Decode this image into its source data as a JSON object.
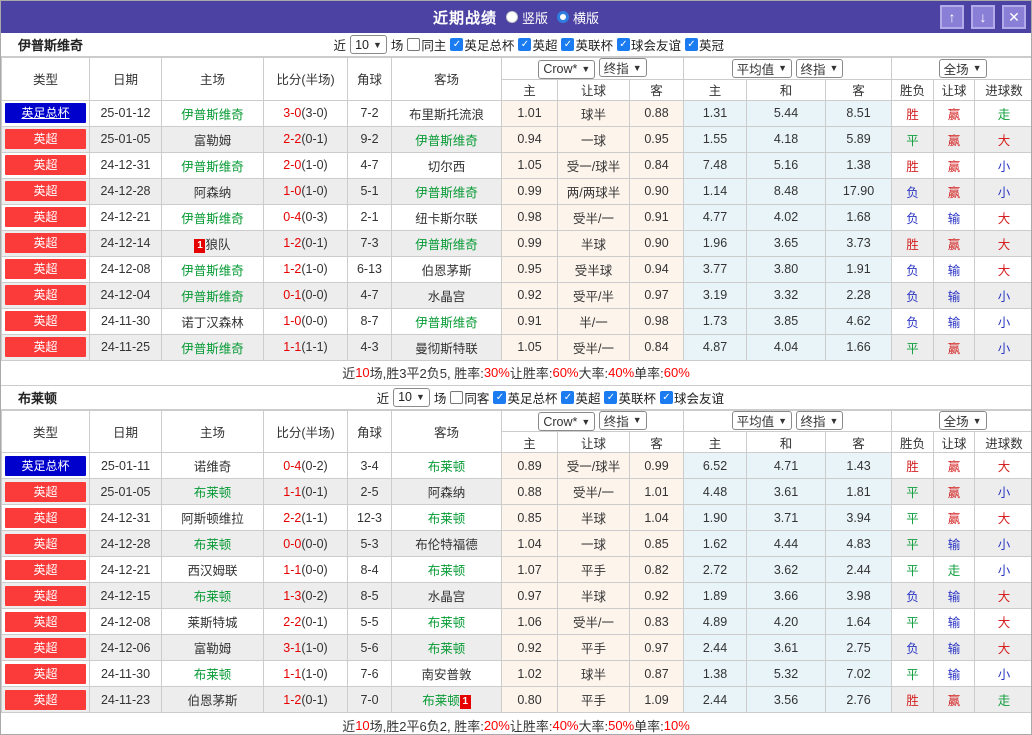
{
  "window": {
    "title": "近期战绩",
    "radios": [
      {
        "label": "竖版",
        "selected": false
      },
      {
        "label": "横版",
        "selected": true
      }
    ],
    "icons": {
      "up": "↑",
      "down": "↓",
      "close": "✕"
    }
  },
  "filter_labels": {
    "near": "近",
    "count": "10",
    "games": "场"
  },
  "columns": [
    "类型",
    "日期",
    "主场",
    "比分(半场)",
    "角球",
    "客场"
  ],
  "odds_header": {
    "crow_select": "Crow*",
    "final_select": "终指",
    "avg_select": "平均值",
    "avg_final_select": "终指",
    "scope_select": "全场",
    "crow_cols": [
      "主",
      "让球",
      "客"
    ],
    "avg_cols": [
      "主",
      "和",
      "客"
    ],
    "result_cols": [
      "胜负",
      "让球",
      "进球数"
    ]
  },
  "colors": {
    "titlebar_purple": "#4c42a3",
    "button_purple": "#8a7fd6",
    "league_cup_blue": "#0000cc",
    "league_epl_red": "#fb3a3a",
    "self_team_green": "#089b35",
    "score_red": "#e60000",
    "win_red": "#d42121",
    "draw_green": "#0f9e3c",
    "lose_blue": "#2b35c4",
    "checkbox_blue": "#1a7cf0",
    "odds_col_cream": "#fdf4ec",
    "avg_col_blue": "#e9f4f9"
  },
  "sections": [
    {
      "team": "伊普斯维奇",
      "same_label": "同主",
      "league_filters": [
        "英足总杯",
        "英超",
        "英联杯",
        "球会友谊",
        "英冠"
      ],
      "rows": [
        {
          "league": "英足总杯",
          "league_color": "blue",
          "league_underline": true,
          "date": "25-01-12",
          "home": {
            "name": "伊普斯维奇",
            "self": true
          },
          "ft": "3-0",
          "ht": "(3-0)",
          "corner": "7-2",
          "away": {
            "name": "布里斯托流浪",
            "self": false
          },
          "odds": [
            "1.01",
            "球半",
            "0.88"
          ],
          "avg": [
            "1.31",
            "5.44",
            "8.51"
          ],
          "results": [
            "胜",
            "赢",
            "走"
          ]
        },
        {
          "league": "英超",
          "league_color": "red",
          "date": "25-01-05",
          "home": {
            "name": "富勒姆",
            "self": false
          },
          "ft": "2-2",
          "ht": "(0-1)",
          "corner": "9-2",
          "away": {
            "name": "伊普斯维奇",
            "self": true
          },
          "odds": [
            "0.94",
            "一球",
            "0.95"
          ],
          "avg": [
            "1.55",
            "4.18",
            "5.89"
          ],
          "results": [
            "平",
            "赢",
            "大"
          ]
        },
        {
          "league": "英超",
          "league_color": "red",
          "date": "24-12-31",
          "home": {
            "name": "伊普斯维奇",
            "self": true
          },
          "ft": "2-0",
          "ht": "(1-0)",
          "corner": "4-7",
          "away": {
            "name": "切尔西",
            "self": false
          },
          "odds": [
            "1.05",
            "受一/球半",
            "0.84"
          ],
          "avg": [
            "7.48",
            "5.16",
            "1.38"
          ],
          "results": [
            "胜",
            "赢",
            "小"
          ]
        },
        {
          "league": "英超",
          "league_color": "red",
          "date": "24-12-28",
          "home": {
            "name": "阿森纳",
            "self": false
          },
          "ft": "1-0",
          "ht": "(1-0)",
          "corner": "5-1",
          "away": {
            "name": "伊普斯维奇",
            "self": true
          },
          "odds": [
            "0.99",
            "两/两球半",
            "0.90"
          ],
          "avg": [
            "1.14",
            "8.48",
            "17.90"
          ],
          "results": [
            "负",
            "赢",
            "小"
          ]
        },
        {
          "league": "英超",
          "league_color": "red",
          "date": "24-12-21",
          "home": {
            "name": "伊普斯维奇",
            "self": true
          },
          "ft": "0-4",
          "ht": "(0-3)",
          "corner": "2-1",
          "away": {
            "name": "纽卡斯尔联",
            "self": false
          },
          "odds": [
            "0.98",
            "受半/一",
            "0.91"
          ],
          "avg": [
            "4.77",
            "4.02",
            "1.68"
          ],
          "results": [
            "负",
            "输",
            "大"
          ]
        },
        {
          "league": "英超",
          "league_color": "red",
          "date": "24-12-14",
          "home": {
            "name": "狼队",
            "self": false,
            "card": "before"
          },
          "ft": "1-2",
          "ht": "(0-1)",
          "corner": "7-3",
          "away": {
            "name": "伊普斯维奇",
            "self": true
          },
          "odds": [
            "0.99",
            "半球",
            "0.90"
          ],
          "avg": [
            "1.96",
            "3.65",
            "3.73"
          ],
          "results": [
            "胜",
            "赢",
            "大"
          ]
        },
        {
          "league": "英超",
          "league_color": "red",
          "date": "24-12-08",
          "home": {
            "name": "伊普斯维奇",
            "self": true
          },
          "ft": "1-2",
          "ht": "(1-0)",
          "corner": "6-13",
          "away": {
            "name": "伯恩茅斯",
            "self": false
          },
          "odds": [
            "0.95",
            "受半球",
            "0.94"
          ],
          "avg": [
            "3.77",
            "3.80",
            "1.91"
          ],
          "results": [
            "负",
            "输",
            "大"
          ]
        },
        {
          "league": "英超",
          "league_color": "red",
          "date": "24-12-04",
          "home": {
            "name": "伊普斯维奇",
            "self": true
          },
          "ft": "0-1",
          "ht": "(0-0)",
          "corner": "4-7",
          "away": {
            "name": "水晶宫",
            "self": false
          },
          "odds": [
            "0.92",
            "受平/半",
            "0.97"
          ],
          "avg": [
            "3.19",
            "3.32",
            "2.28"
          ],
          "results": [
            "负",
            "输",
            "小"
          ]
        },
        {
          "league": "英超",
          "league_color": "red",
          "date": "24-11-30",
          "home": {
            "name": "诺丁汉森林",
            "self": false
          },
          "ft": "1-0",
          "ht": "(0-0)",
          "corner": "8-7",
          "away": {
            "name": "伊普斯维奇",
            "self": true
          },
          "odds": [
            "0.91",
            "半/一",
            "0.98"
          ],
          "avg": [
            "1.73",
            "3.85",
            "4.62"
          ],
          "results": [
            "负",
            "输",
            "小"
          ]
        },
        {
          "league": "英超",
          "league_color": "red",
          "date": "24-11-25",
          "home": {
            "name": "伊普斯维奇",
            "self": true
          },
          "ft": "1-1",
          "ht": "(1-1)",
          "corner": "4-3",
          "away": {
            "name": "曼彻斯特联",
            "self": false
          },
          "odds": [
            "1.05",
            "受半/一",
            "0.84"
          ],
          "avg": [
            "4.87",
            "4.04",
            "1.66"
          ],
          "results": [
            "平",
            "赢",
            "小"
          ]
        }
      ],
      "summary": [
        {
          "t": "近"
        },
        {
          "t": "10",
          "red": true
        },
        {
          "t": "场,胜3平2负5, 胜率:"
        },
        {
          "t": "30%",
          "red": true
        },
        {
          "t": " 让胜率:"
        },
        {
          "t": "60%",
          "red": true
        },
        {
          "t": " 大率:"
        },
        {
          "t": "40%",
          "red": true
        },
        {
          "t": " 单率:"
        },
        {
          "t": "60%",
          "red": true
        }
      ]
    },
    {
      "team": "布莱顿",
      "same_label": "同客",
      "league_filters": [
        "英足总杯",
        "英超",
        "英联杯",
        "球会友谊"
      ],
      "rows": [
        {
          "league": "英足总杯",
          "league_color": "blue",
          "date": "25-01-11",
          "home": {
            "name": "诺维奇",
            "self": false
          },
          "ft": "0-4",
          "ht": "(0-2)",
          "corner": "3-4",
          "away": {
            "name": "布莱顿",
            "self": true
          },
          "odds": [
            "0.89",
            "受一/球半",
            "0.99"
          ],
          "avg": [
            "6.52",
            "4.71",
            "1.43"
          ],
          "results": [
            "胜",
            "赢",
            "大"
          ]
        },
        {
          "league": "英超",
          "league_color": "red",
          "date": "25-01-05",
          "home": {
            "name": "布莱顿",
            "self": true
          },
          "ft": "1-1",
          "ht": "(0-1)",
          "corner": "2-5",
          "away": {
            "name": "阿森纳",
            "self": false
          },
          "odds": [
            "0.88",
            "受半/一",
            "1.01"
          ],
          "avg": [
            "4.48",
            "3.61",
            "1.81"
          ],
          "results": [
            "平",
            "赢",
            "小"
          ]
        },
        {
          "league": "英超",
          "league_color": "red",
          "date": "24-12-31",
          "home": {
            "name": "阿斯顿维拉",
            "self": false
          },
          "ft": "2-2",
          "ht": "(1-1)",
          "corner": "12-3",
          "away": {
            "name": "布莱顿",
            "self": true
          },
          "odds": [
            "0.85",
            "半球",
            "1.04"
          ],
          "avg": [
            "1.90",
            "3.71",
            "3.94"
          ],
          "results": [
            "平",
            "赢",
            "大"
          ]
        },
        {
          "league": "英超",
          "league_color": "red",
          "date": "24-12-28",
          "home": {
            "name": "布莱顿",
            "self": true
          },
          "ft": "0-0",
          "ht": "(0-0)",
          "corner": "5-3",
          "away": {
            "name": "布伦特福德",
            "self": false
          },
          "odds": [
            "1.04",
            "一球",
            "0.85"
          ],
          "avg": [
            "1.62",
            "4.44",
            "4.83"
          ],
          "results": [
            "平",
            "输",
            "小"
          ]
        },
        {
          "league": "英超",
          "league_color": "red",
          "date": "24-12-21",
          "home": {
            "name": "西汉姆联",
            "self": false
          },
          "ft": "1-1",
          "ht": "(0-0)",
          "corner": "8-4",
          "away": {
            "name": "布莱顿",
            "self": true
          },
          "odds": [
            "1.07",
            "平手",
            "0.82"
          ],
          "avg": [
            "2.72",
            "3.62",
            "2.44"
          ],
          "results": [
            "平",
            "走",
            "小"
          ]
        },
        {
          "league": "英超",
          "league_color": "red",
          "date": "24-12-15",
          "home": {
            "name": "布莱顿",
            "self": true
          },
          "ft": "1-3",
          "ht": "(0-2)",
          "corner": "8-5",
          "away": {
            "name": "水晶宫",
            "self": false
          },
          "odds": [
            "0.97",
            "半球",
            "0.92"
          ],
          "avg": [
            "1.89",
            "3.66",
            "3.98"
          ],
          "results": [
            "负",
            "输",
            "大"
          ]
        },
        {
          "league": "英超",
          "league_color": "red",
          "date": "24-12-08",
          "home": {
            "name": "莱斯特城",
            "self": false
          },
          "ft": "2-2",
          "ht": "(0-1)",
          "corner": "5-5",
          "away": {
            "name": "布莱顿",
            "self": true
          },
          "odds": [
            "1.06",
            "受半/一",
            "0.83"
          ],
          "avg": [
            "4.89",
            "4.20",
            "1.64"
          ],
          "results": [
            "平",
            "输",
            "大"
          ]
        },
        {
          "league": "英超",
          "league_color": "red",
          "date": "24-12-06",
          "home": {
            "name": "富勒姆",
            "self": false
          },
          "ft": "3-1",
          "ht": "(1-0)",
          "corner": "5-6",
          "away": {
            "name": "布莱顿",
            "self": true
          },
          "odds": [
            "0.92",
            "平手",
            "0.97"
          ],
          "avg": [
            "2.44",
            "3.61",
            "2.75"
          ],
          "results": [
            "负",
            "输",
            "大"
          ]
        },
        {
          "league": "英超",
          "league_color": "red",
          "date": "24-11-30",
          "home": {
            "name": "布莱顿",
            "self": true
          },
          "ft": "1-1",
          "ht": "(1-0)",
          "corner": "7-6",
          "away": {
            "name": "南安普敦",
            "self": false
          },
          "odds": [
            "1.02",
            "球半",
            "0.87"
          ],
          "avg": [
            "1.38",
            "5.32",
            "7.02"
          ],
          "results": [
            "平",
            "输",
            "小"
          ]
        },
        {
          "league": "英超",
          "league_color": "red",
          "date": "24-11-23",
          "home": {
            "name": "伯恩茅斯",
            "self": false
          },
          "ft": "1-2",
          "ht": "(0-1)",
          "corner": "7-0",
          "away": {
            "name": "布莱顿",
            "self": true,
            "card": "after"
          },
          "odds": [
            "0.80",
            "平手",
            "1.09"
          ],
          "avg": [
            "2.44",
            "3.56",
            "2.76"
          ],
          "results": [
            "胜",
            "赢",
            "走"
          ]
        }
      ],
      "summary": [
        {
          "t": "近"
        },
        {
          "t": "10",
          "red": true
        },
        {
          "t": "场,胜2平6负2, 胜率:"
        },
        {
          "t": "20%",
          "red": true
        },
        {
          "t": " 让胜率:"
        },
        {
          "t": "40%",
          "red": true
        },
        {
          "t": " 大率:"
        },
        {
          "t": "50%",
          "red": true
        },
        {
          "t": " 单率:"
        },
        {
          "t": "10%",
          "red": true
        }
      ]
    }
  ]
}
